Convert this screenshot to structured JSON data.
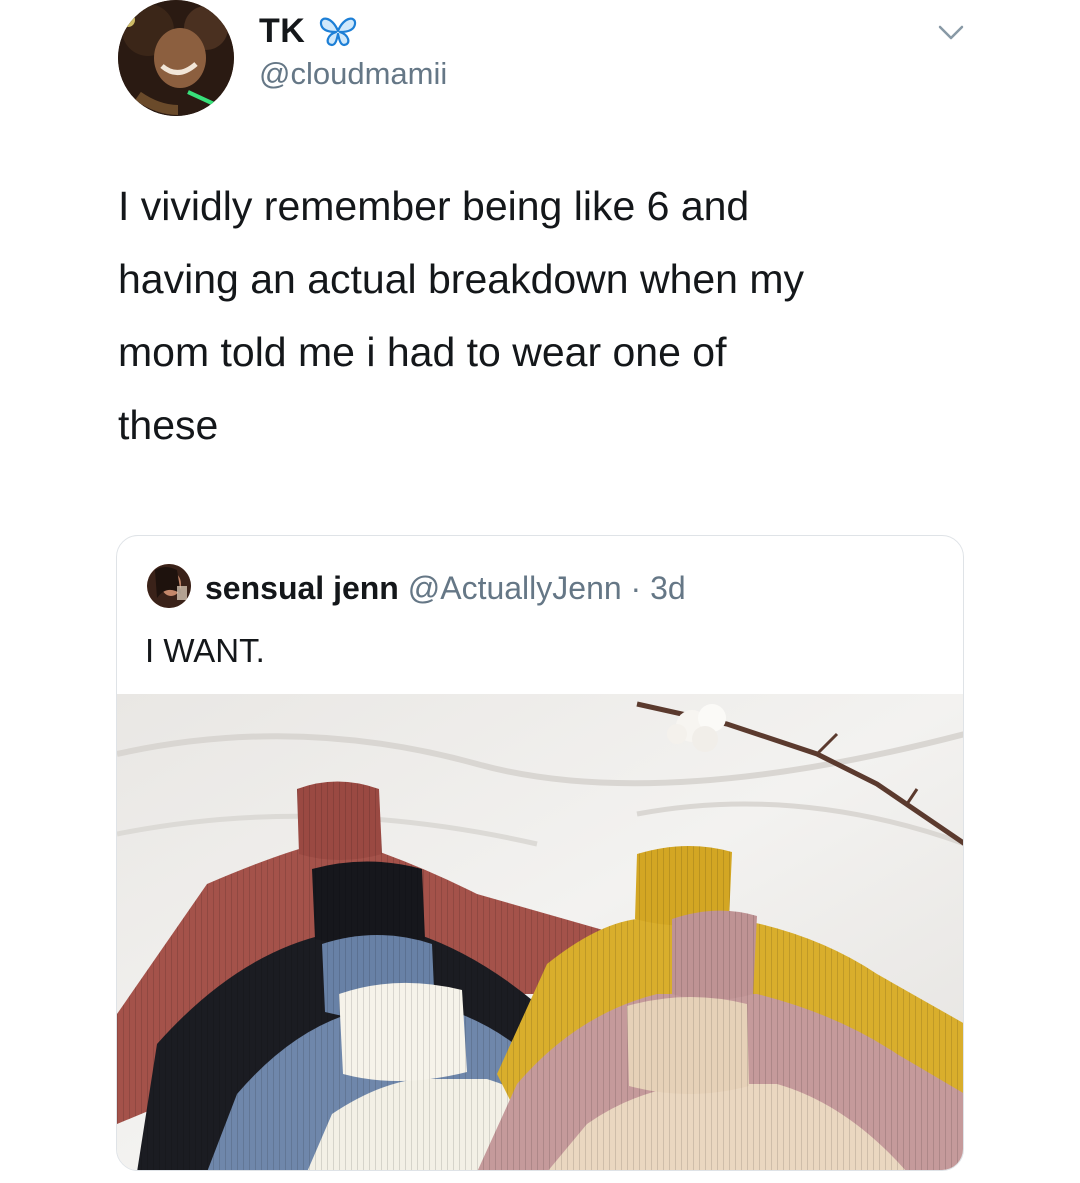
{
  "tweet": {
    "author": {
      "display_name": "TK",
      "handle": "@cloudmamii",
      "name_emoji_icon": "butterfly-icon"
    },
    "text": "I vividly remember being like 6 and\nhaving an actual breakdown when my\nmom told me i had to wear one of\nthese"
  },
  "quoted_tweet": {
    "author": {
      "display_name": "sensual jenn",
      "handle": "@ActuallyJenn",
      "separator": " · ",
      "time": "3d"
    },
    "text": "I WANT.",
    "media_icon": "turtleneck-sweaters-photo"
  },
  "colors": {
    "accent_blue": "#1da1f2",
    "handle_gray": "#657786",
    "sweater_rust": "#a4524a",
    "sweater_black": "#1b1c22",
    "sweater_blue": "#6f87ab",
    "sweater_white": "#f3f0e6",
    "sweater_mustard": "#d9ae2c",
    "sweater_mauve": "#c59a9b",
    "sweater_cream": "#ead7c0"
  }
}
